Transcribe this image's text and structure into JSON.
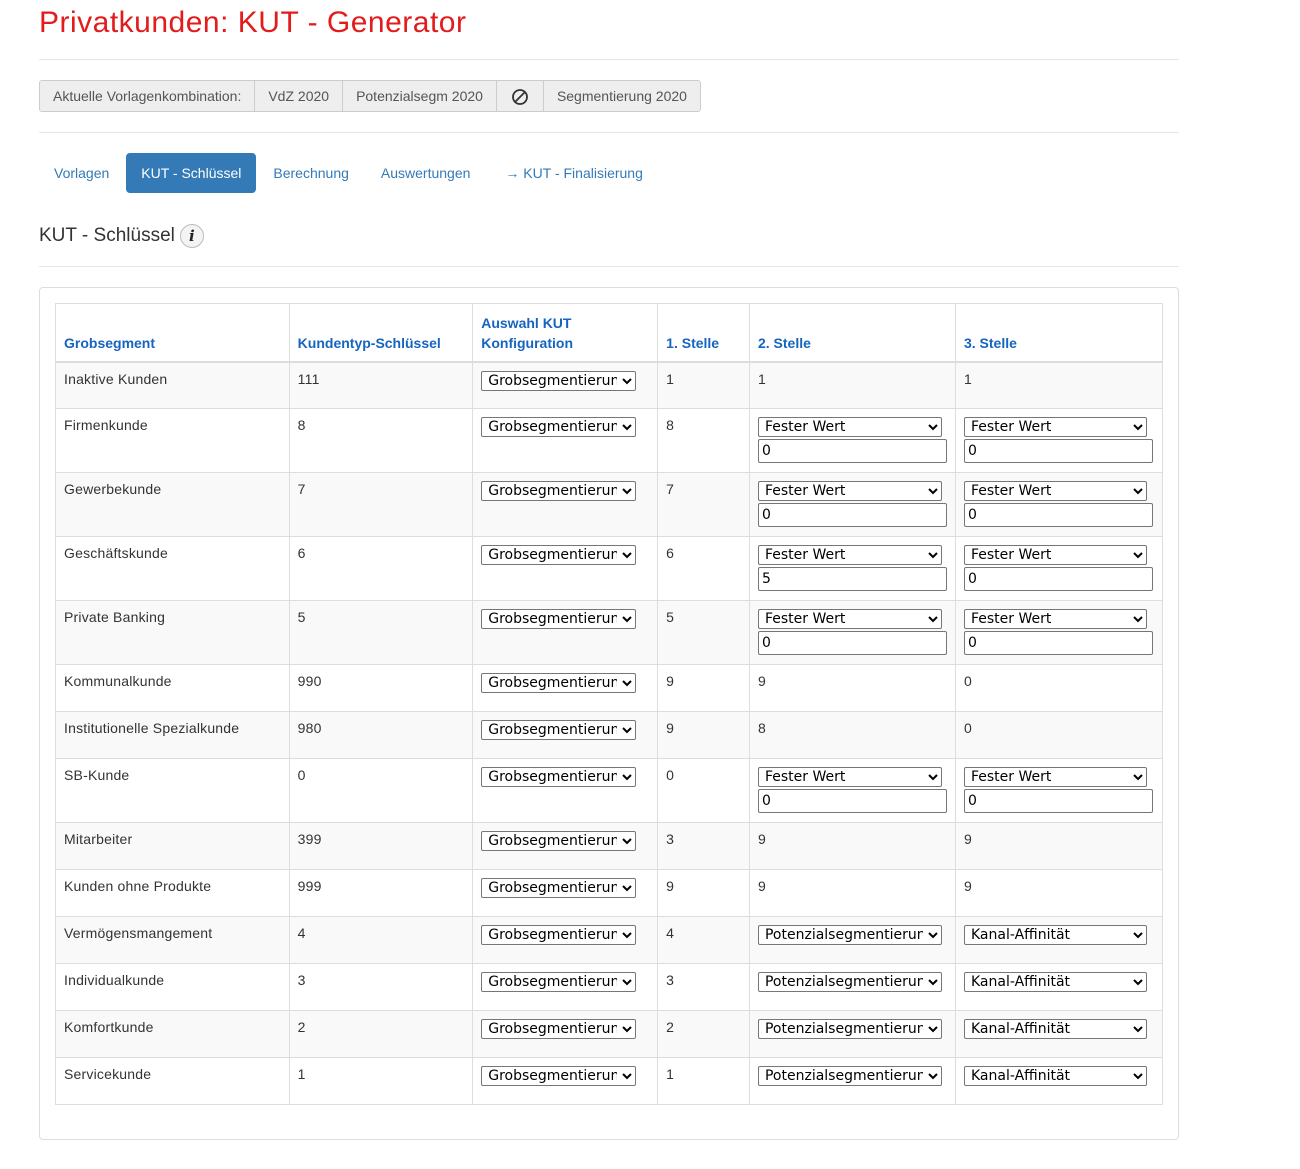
{
  "page": {
    "title": "Privatkunden: KUT - Generator"
  },
  "combination": {
    "label": "Aktuelle Vorlagenkombination:",
    "items": [
      "VdZ 2020",
      "Potenzialsegm 2020",
      "Segmentierung 2020"
    ],
    "empty_icon": "ban-icon"
  },
  "tabs": [
    {
      "label": "Vorlagen",
      "active": false
    },
    {
      "label": "KUT - Schlüssel",
      "active": true
    },
    {
      "label": "Berechnung",
      "active": false
    },
    {
      "label": "Auswertungen",
      "active": false
    },
    {
      "label": "→ KUT - Finalisierung",
      "active": false
    }
  ],
  "section": {
    "title": "KUT - Schlüssel",
    "info_icon": "info-icon"
  },
  "table": {
    "headers": {
      "segment": "Grobsegment",
      "key": "Kundentyp-Schlüssel",
      "config": "Auswahl KUT Konfiguration",
      "pos1": "1. Stelle",
      "pos2": "2. Stelle",
      "pos3": "3. Stelle"
    },
    "rows": [
      {
        "segment": "Inaktive Kunden",
        "key": "111",
        "config": "Grobsegmentierung",
        "pos1": "1",
        "pos2": "1",
        "pos3": "1"
      },
      {
        "segment": "Firmenkunde",
        "key": "8",
        "config": "Grobsegmentierung",
        "pos1": "8",
        "pos2_select": "Fester Wert",
        "pos2_value": "0",
        "pos3_select": "Fester Wert",
        "pos3_value": "0"
      },
      {
        "segment": "Gewerbekunde",
        "key": "7",
        "config": "Grobsegmentierung",
        "pos1": "7",
        "pos2_select": "Fester Wert",
        "pos2_value": "0",
        "pos3_select": "Fester Wert",
        "pos3_value": "0"
      },
      {
        "segment": "Geschäftskunde",
        "key": "6",
        "config": "Grobsegmentierung",
        "pos1": "6",
        "pos2_select": "Fester Wert",
        "pos2_value": "5",
        "pos3_select": "Fester Wert",
        "pos3_value": "0"
      },
      {
        "segment": "Private Banking",
        "key": "5",
        "config": "Grobsegmentierung",
        "pos1": "5",
        "pos2_select": "Fester Wert",
        "pos2_value": "0",
        "pos3_select": "Fester Wert",
        "pos3_value": "0"
      },
      {
        "segment": "Kommunalkunde",
        "key": "990",
        "config": "Grobsegmentierung",
        "pos1": "9",
        "pos2": "9",
        "pos3": "0"
      },
      {
        "segment": "Institutionelle Spezialkunde",
        "key": "980",
        "config": "Grobsegmentierung",
        "pos1": "9",
        "pos2": "8",
        "pos3": "0"
      },
      {
        "segment": "SB-Kunde",
        "key": "0",
        "config": "Grobsegmentierung",
        "pos1": "0",
        "pos2_select": "Fester Wert",
        "pos2_value": "0",
        "pos3_select": "Fester Wert",
        "pos3_value": "0"
      },
      {
        "segment": "Mitarbeiter",
        "key": "399",
        "config": "Grobsegmentierung",
        "pos1": "3",
        "pos2": "9",
        "pos3": "9"
      },
      {
        "segment": "Kunden ohne Produkte",
        "key": "999",
        "config": "Grobsegmentierung",
        "pos1": "9",
        "pos2": "9",
        "pos3": "9"
      },
      {
        "segment": "Vermögensmangement",
        "key": "4",
        "config": "Grobsegmentierung",
        "pos1": "4",
        "pos2_select": "Potenzialsegmentierung",
        "pos3_select": "Kanal-Affinität"
      },
      {
        "segment": "Individualkunde",
        "key": "3",
        "config": "Grobsegmentierung",
        "pos1": "3",
        "pos2_select": "Potenzialsegmentierung",
        "pos3_select": "Kanal-Affinität"
      },
      {
        "segment": "Komfortkunde",
        "key": "2",
        "config": "Grobsegmentierung",
        "pos1": "2",
        "pos2_select": "Potenzialsegmentierung",
        "pos3_select": "Kanal-Affinität"
      },
      {
        "segment": "Servicekunde",
        "key": "1",
        "config": "Grobsegmentierung",
        "pos1": "1",
        "pos2_select": "Potenzialsegmentierung",
        "pos3_select": "Kanal-Affinität"
      }
    ]
  }
}
